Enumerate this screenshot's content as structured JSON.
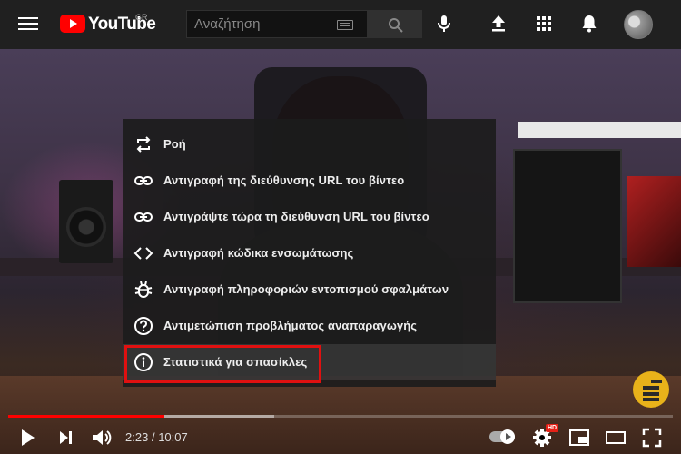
{
  "header": {
    "logo_text": "YouTube",
    "region_code": "GR",
    "search": {
      "placeholder": "Αναζήτηση",
      "value": ""
    }
  },
  "context_menu": {
    "items": [
      {
        "label": "Ροή",
        "icon": "loop-icon"
      },
      {
        "label": "Αντιγραφή της διεύθυνσης URL του βίντεο",
        "icon": "link-icon"
      },
      {
        "label": "Αντιγράψτε τώρα τη διεύθυνση URL του βίντεο",
        "icon": "link-icon"
      },
      {
        "label": "Αντιγραφή κώδικα ενσωμάτωσης",
        "icon": "code-icon"
      },
      {
        "label": "Αντιγραφή πληροφοριών εντοπισμού σφαλμάτων",
        "icon": "bug-icon"
      },
      {
        "label": "Αντιμετώπιση προβλήματος αναπαραγωγής",
        "icon": "help-icon"
      },
      {
        "label": "Στατιστικά για σπασίκλες",
        "icon": "info-icon"
      }
    ],
    "highlighted_index": 6,
    "highlight_color": "#e01010"
  },
  "player": {
    "current_time": "2:23",
    "separator": "/",
    "duration": "10:07",
    "played_fraction": 0.2356,
    "loaded_fraction": 0.4,
    "hd_badge": "HD",
    "accent_color": "#ff0000"
  }
}
